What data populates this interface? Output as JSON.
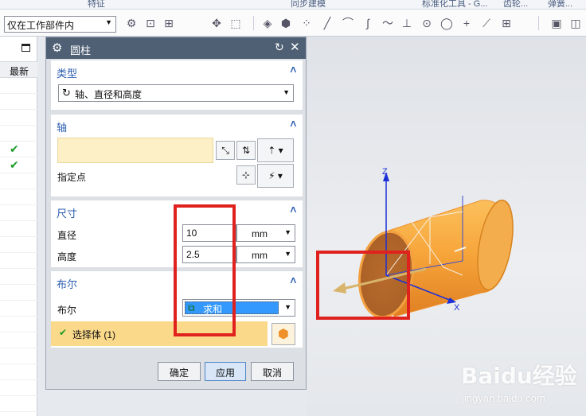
{
  "ribbon": {
    "labels": [
      "特征",
      "同步建模",
      "标准化工具 - G...",
      "齿轮...",
      "弹簧..."
    ]
  },
  "toolbar": {
    "scope_value": "仅在工作部件内",
    "icons": [
      "snap-icon",
      "select-filter-icon",
      "point-snap-icon",
      "quick-pick-icon",
      "box-select-icon",
      "shaded-icon",
      "solid-icon",
      "point-icon",
      "line-icon",
      "arc-icon",
      "curve-icon",
      "center-icon",
      "circle-icon",
      "plus-icon",
      "orient-icon",
      "view-icon"
    ]
  },
  "navigator": {
    "header": "最新",
    "checks": [
      "✔",
      "✔"
    ]
  },
  "dialog": {
    "title": "圆柱",
    "type_section": {
      "label": "类型",
      "value": "轴、直径和高度"
    },
    "axis_section": {
      "label": "轴",
      "specify_point": "指定点"
    },
    "dims_section": {
      "label": "尺寸",
      "diameter_label": "直径",
      "diameter_value": "10",
      "diameter_unit": "mm",
      "height_label": "高度",
      "height_value": "2.5",
      "height_unit": "mm"
    },
    "bool_section": {
      "label": "布尔",
      "bool_label": "布尔",
      "bool_value": "求和",
      "select_body": "选择体 (1)"
    },
    "buttons": {
      "ok": "确定",
      "apply": "应用",
      "cancel": "取消"
    }
  },
  "viewport": {
    "axis_labels": {
      "z": "Z",
      "x": "X"
    },
    "watermark": {
      "logo": "Baidu经验",
      "url": "jingyan.baidu.com"
    }
  },
  "colors": {
    "title_bar": "#4f6075",
    "section_label": "#2a5db0",
    "highlight_red": "#e0221f",
    "bool_selected": "#3399ff",
    "select_row": "#fbd98a",
    "cylinder": "#f2a23c"
  }
}
